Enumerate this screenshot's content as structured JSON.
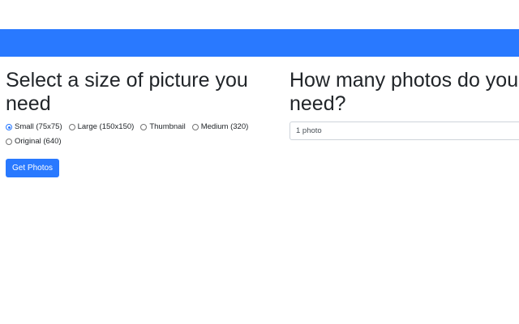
{
  "size_section": {
    "heading": "Select a size of picture you need",
    "options": [
      {
        "label": "Small (75x75)",
        "checked": true
      },
      {
        "label": "Large (150x150)",
        "checked": false
      },
      {
        "label": "Thumbnail",
        "checked": false
      },
      {
        "label": "Medium (320)",
        "checked": false
      },
      {
        "label": "Original (640)",
        "checked": false
      }
    ],
    "button_label": "Get Photos"
  },
  "count_section": {
    "heading": "How many photos do you need?",
    "selected_value": "1 photo"
  },
  "colors": {
    "accent": "#2979ff"
  }
}
